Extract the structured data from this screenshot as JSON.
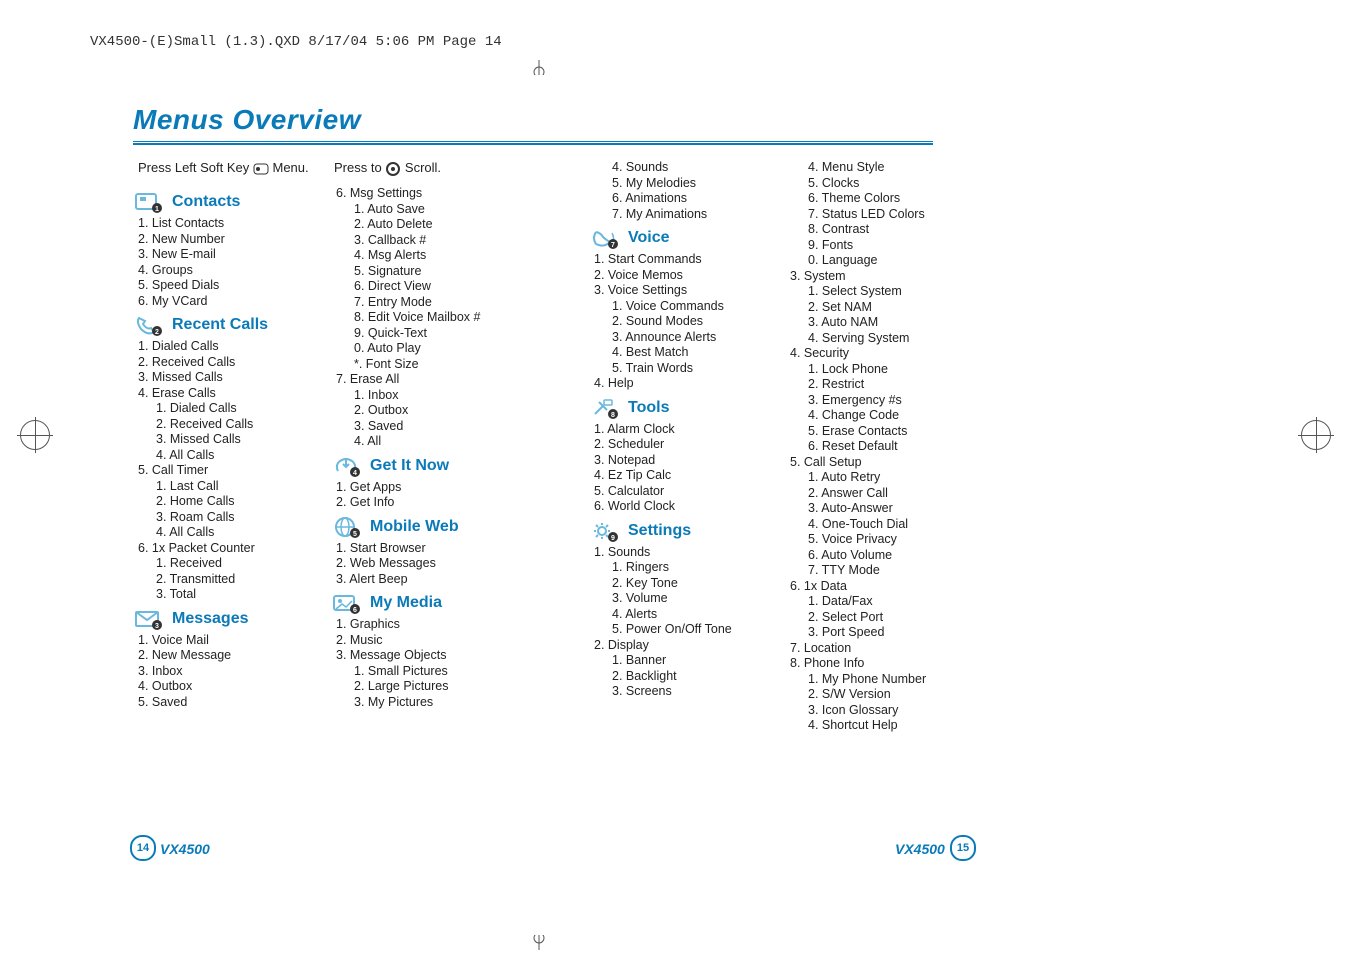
{
  "meta": {
    "header": "VX4500-(E)Small (1.3).QXD  8/17/04  5:06 PM  Page 14"
  },
  "title": "Menus Overview",
  "instructions": {
    "left": {
      "pre": "Press Left Soft Key ",
      "post": " Menu."
    },
    "right": {
      "pre": "Press to ",
      "post": " Scroll."
    }
  },
  "sections": {
    "contacts": {
      "label": "Contacts",
      "items": [
        "1. List Contacts",
        "2. New Number",
        "3. New E-mail",
        "4. Groups",
        "5. Speed Dials",
        "6. My VCard"
      ]
    },
    "recent": {
      "label": "Recent Calls",
      "items": [
        "1. Dialed Calls",
        "2. Received Calls",
        "3. Missed Calls",
        "4. Erase Calls"
      ],
      "erase_sub": [
        "1. Dialed Calls",
        "2. Received Calls",
        "3. Missed Calls",
        "4. All Calls"
      ],
      "timer_label": "5. Call Timer",
      "timer_sub": [
        "1. Last Call",
        "2. Home Calls",
        "3. Roam Calls",
        "4. All Calls"
      ],
      "packet_label": "6. 1x Packet Counter",
      "packet_sub": [
        "1. Received",
        "2. Transmitted",
        "3. Total"
      ]
    },
    "messages": {
      "label": "Messages",
      "items": [
        "1. Voice Mail",
        "2. New Message",
        "3. Inbox",
        "4. Outbox",
        "5. Saved"
      ]
    },
    "msgcont": {
      "settings_label": "6. Msg Settings",
      "settings_sub": [
        "1. Auto Save",
        "2. Auto Delete",
        "3. Callback #",
        "4. Msg Alerts",
        "5. Signature",
        "6. Direct View",
        "7. Entry Mode",
        "8. Edit Voice Mailbox #",
        "9. Quick-Text",
        "0. Auto Play",
        "*. Font Size"
      ],
      "erase_label": "7. Erase All",
      "erase_sub": [
        "1. Inbox",
        "2. Outbox",
        "3. Saved",
        "4. All"
      ]
    },
    "getitnow": {
      "label": "Get It Now",
      "items": [
        "1. Get Apps",
        "2. Get Info"
      ]
    },
    "mobileweb": {
      "label": "Mobile Web",
      "items": [
        "1. Start Browser",
        "2. Web Messages",
        "3. Alert Beep"
      ]
    },
    "mymedia": {
      "label": "My Media",
      "items": [
        "1. Graphics",
        "2. Music",
        "3. Message Objects"
      ],
      "msgobj_sub": [
        "1. Small Pictures",
        "2. Large Pictures",
        "3. My Pictures"
      ]
    },
    "mymedia_cont": [
      "4. Sounds",
      "5. My Melodies",
      "6. Animations",
      "7. My Animations"
    ],
    "voice": {
      "label": "Voice",
      "items": [
        "1. Start Commands",
        "2. Voice Memos",
        "3. Voice Settings"
      ],
      "settings_sub": [
        "1. Voice Commands",
        "2. Sound Modes",
        "3. Announce Alerts",
        "4. Best Match",
        "5. Train Words"
      ],
      "help": "4. Help"
    },
    "tools": {
      "label": "Tools",
      "items": [
        "1. Alarm Clock",
        "2. Scheduler",
        "3. Notepad",
        "4. Ez Tip Calc",
        "5. Calculator",
        "6. World Clock"
      ]
    },
    "settings": {
      "label": "Settings",
      "sounds_label": "1. Sounds",
      "sounds_sub": [
        "1. Ringers",
        "2. Key Tone",
        "3. Volume",
        "4. Alerts",
        "5. Power On/Off Tone"
      ],
      "display_label": "2. Display",
      "display_sub": [
        "1. Banner",
        "2. Backlight",
        "3. Screens"
      ]
    },
    "settings_cont": {
      "display_more": [
        "4. Menu Style",
        "5. Clocks",
        "6. Theme Colors",
        "7. Status LED Colors",
        "8. Contrast",
        "9. Fonts",
        "0. Language"
      ],
      "system_label": "3. System",
      "system_sub": [
        "1. Select System",
        "2. Set NAM",
        "3. Auto NAM",
        "4. Serving System"
      ],
      "security_label": "4. Security",
      "security_sub": [
        "1. Lock Phone",
        "2. Restrict",
        "3. Emergency #s",
        "4. Change Code",
        "5. Erase Contacts",
        "6. Reset Default"
      ],
      "callsetup_label": "5. Call Setup",
      "callsetup_sub": [
        "1. Auto Retry",
        "2. Answer Call",
        "3. Auto-Answer",
        "4. One-Touch Dial",
        "5. Voice Privacy",
        "6. Auto Volume",
        "7. TTY Mode"
      ],
      "data_label": "6. 1x Data",
      "data_sub": [
        "1. Data/Fax",
        "2. Select Port",
        "3. Port Speed"
      ],
      "location_label": "7. Location",
      "phoneinfo_label": "8. Phone Info",
      "phoneinfo_sub": [
        "1. My Phone Number",
        "2. S/W Version",
        "3. Icon Glossary",
        "4. Shortcut Help"
      ]
    }
  },
  "footer": {
    "page_left": "14",
    "page_right": "15",
    "model": "VX4500"
  }
}
